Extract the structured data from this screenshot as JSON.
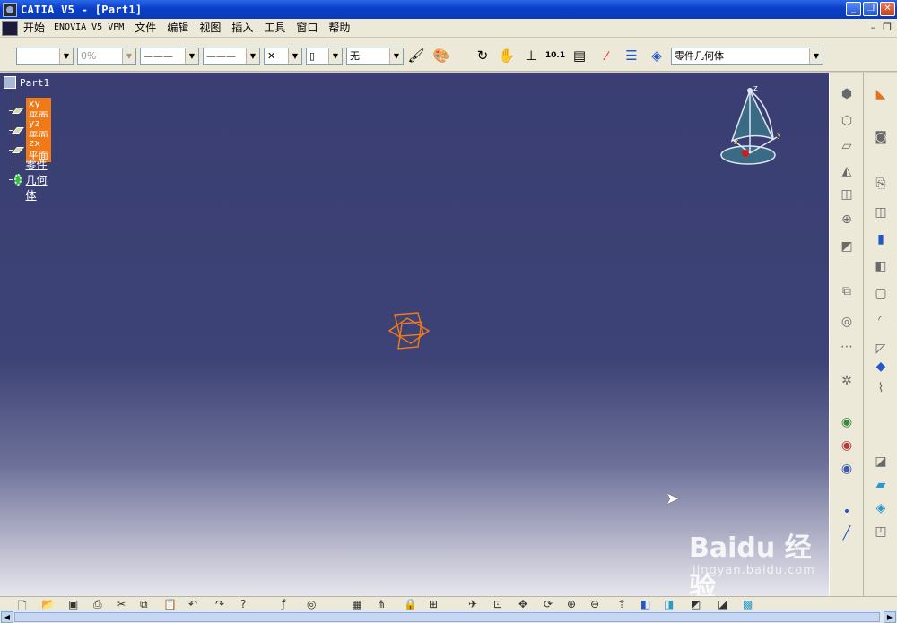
{
  "window": {
    "title": "CATIA V5 - [Part1]",
    "minimize": "_",
    "restore": "❐",
    "close": "✕"
  },
  "menu": {
    "items": [
      "开始",
      "ENOVIA V5 VPM",
      "文件",
      "编辑",
      "视图",
      "插入",
      "工具",
      "窗口",
      "帮助"
    ],
    "mdi_minimize": "–",
    "mdi_restore": "❐"
  },
  "toolbar": {
    "color_value": "",
    "transparency_value": "0%",
    "line_thickness_value": "———",
    "line_type_value": "———",
    "point_symbol_value": "✕",
    "layer_value": "▯",
    "render_style_value": "无",
    "current_body": "零件几何体",
    "icons": [
      "paint-brush-icon",
      "properties-icon",
      "hand-icon",
      "pan-icon",
      "axis-icon",
      "units-icon",
      "cube-icon",
      "dimension-icon",
      "list-icon",
      "layer-icon"
    ]
  },
  "tree": {
    "root": "Part1",
    "planes": [
      "xy 平面",
      "yz 平面",
      "zx 平面"
    ],
    "body": "零件几何体"
  },
  "compass": {
    "x": "x",
    "y": "y",
    "z": "z"
  },
  "watermark": {
    "text": "Baidu 经验",
    "sub": "jingyan.baidu.com"
  },
  "colors": {
    "title_bar": "#0a3fc8",
    "menu_bg": "#ece9d8",
    "viewport_top": "#3a3e72",
    "plane_highlight": "#f07a18",
    "axis_orange": "#f07a18",
    "compass_accent": "#d61818"
  }
}
